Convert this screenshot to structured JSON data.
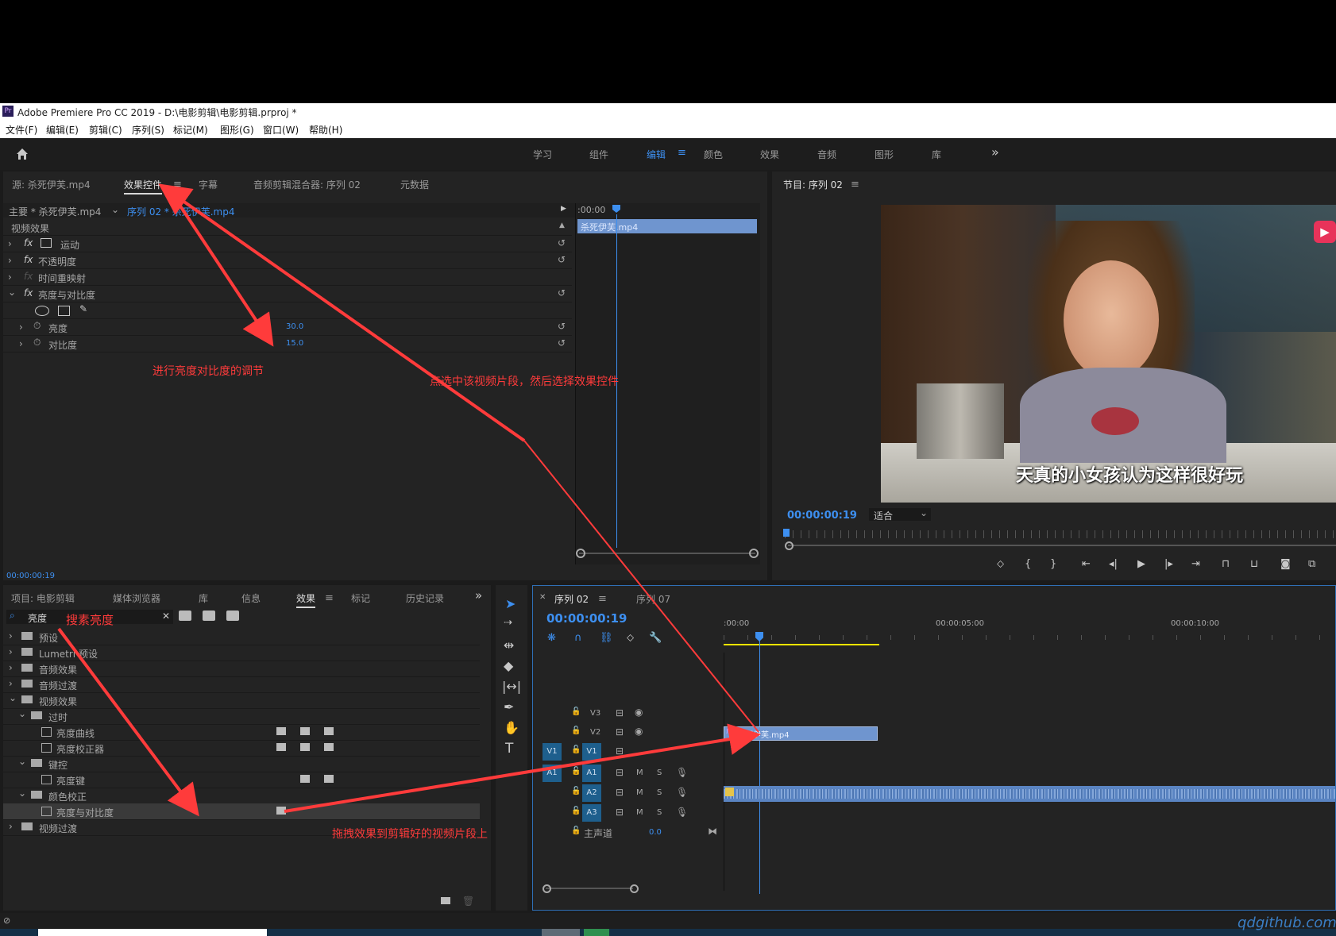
{
  "titlebar": {
    "title": "Adobe Premiere Pro CC 2019 - D:\\电影剪辑\\电影剪辑.prproj *"
  },
  "menubar": {
    "items": [
      "文件(F)",
      "编辑(E)",
      "剪辑(C)",
      "序列(S)",
      "标记(M)",
      "图形(G)",
      "窗口(W)",
      "帮助(H)"
    ]
  },
  "workspaces": {
    "items": [
      "学习",
      "组件",
      "编辑",
      "颜色",
      "效果",
      "音频",
      "图形",
      "库"
    ],
    "active": "编辑",
    "more": "»"
  },
  "effect_controls": {
    "tabs": [
      "源: 杀死伊芙.mp4",
      "效果控件",
      "字幕",
      "音频剪辑混合器: 序列 02",
      "元数据"
    ],
    "master_clip": "主要 * 杀死伊芙.mp4",
    "sequence_clip": "序列 02 * 杀死伊芙.mp4",
    "section": "视频效果",
    "effects": [
      "运动",
      "不透明度",
      "时间重映射",
      "亮度与对比度"
    ],
    "params": [
      {
        "name": "亮度",
        "value": "30.0"
      },
      {
        "name": "对比度",
        "value": "15.0"
      }
    ],
    "timeline_start": ":00:00",
    "clip_label": "杀死伊芙.mp4",
    "timecode": "00:00:00:19"
  },
  "program_monitor": {
    "title": "节目: 序列 02",
    "timecode": "00:00:00:19",
    "fit": "适合",
    "subtitle": "天真的小女孩认为这样很好玩"
  },
  "project_panel": {
    "tabs": [
      "项目: 电影剪辑",
      "媒体浏览器",
      "库",
      "信息",
      "效果",
      "标记",
      "历史记录"
    ],
    "search_value": "亮度",
    "tree": [
      {
        "label": "预设",
        "level": 0
      },
      {
        "label": "Lumetri 预设",
        "level": 0
      },
      {
        "label": "音频效果",
        "level": 0
      },
      {
        "label": "音频过渡",
        "level": 0
      },
      {
        "label": "视频效果",
        "level": 0
      },
      {
        "label": "过时",
        "level": 1
      },
      {
        "label": "亮度曲线",
        "level": 2
      },
      {
        "label": "亮度校正器",
        "level": 2
      },
      {
        "label": "键控",
        "level": 1
      },
      {
        "label": "亮度键",
        "level": 2
      },
      {
        "label": "颜色校正",
        "level": 1
      },
      {
        "label": "亮度与对比度",
        "level": 2
      },
      {
        "label": "视频过渡",
        "level": 0
      }
    ]
  },
  "timeline": {
    "tabs": [
      "序列 02",
      "序列 07"
    ],
    "timecode": "00:00:00:19",
    "ruler": [
      ":00:00",
      "00:00:05:00",
      "00:00:10:00"
    ],
    "video_tracks": [
      "V3",
      "V2",
      "V1"
    ],
    "audio_tracks": [
      "A1",
      "A2",
      "A3"
    ],
    "master_label": "主声道",
    "master_value": "0.0",
    "clip_label": "杀死伊芙.mp4",
    "m_label": "M",
    "s_label": "S",
    "fx_label": "fx"
  },
  "annotations": {
    "adjust": "进行亮度对比度的调节",
    "select_clip": "点选中该视频片段，然后选择效果控件",
    "search": "搜素亮度",
    "drag": "拖拽效果到剪辑好的视频片段上"
  },
  "watermark": "qdgithub.com",
  "colors": {
    "accent": "#3d8ff0",
    "annotation": "#ff3b3b",
    "panel": "#232323",
    "clip_blue": "#6f95cf"
  }
}
